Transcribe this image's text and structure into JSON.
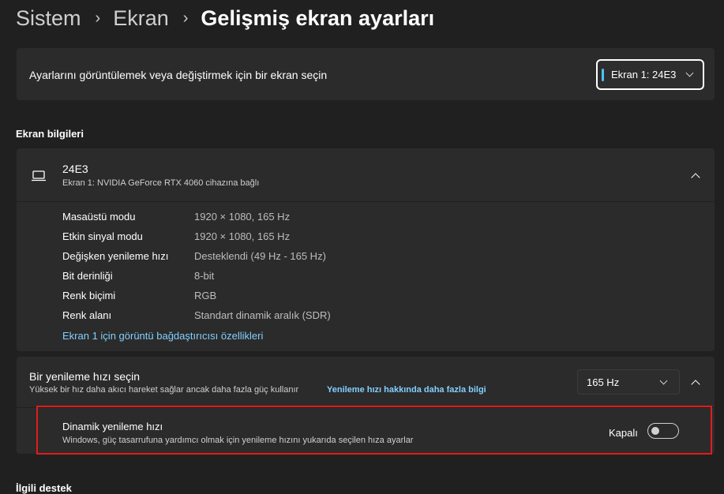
{
  "breadcrumb": {
    "items": [
      "Sistem",
      "Ekran"
    ],
    "current": "Gelişmiş ekran ayarları",
    "separator": "›"
  },
  "display_select": {
    "label": "Ayarlarını görüntülemek veya değiştirmek için bir ekran seçin",
    "value": "Ekran 1: 24E3"
  },
  "display_info": {
    "section_title": "Ekran bilgileri",
    "monitor_name": "24E3",
    "monitor_desc": "Ekran 1: NVIDIA GeForce RTX 4060 cihazına bağlı",
    "rows": [
      {
        "label": "Masaüstü modu",
        "value": "1920 × 1080, 165 Hz"
      },
      {
        "label": "Etkin sinyal modu",
        "value": "1920 × 1080, 165 Hz"
      },
      {
        "label": "Değişken yenileme hızı",
        "value": "Desteklendi (49 Hz - 165 Hz)"
      },
      {
        "label": "Bit derinliği",
        "value": "8-bit"
      },
      {
        "label": "Renk biçimi",
        "value": "RGB"
      },
      {
        "label": "Renk alanı",
        "value": "Standart dinamik aralık (SDR)"
      }
    ],
    "adapter_link": "Ekran 1 için görüntü bağdaştırıcısı özellikleri"
  },
  "refresh": {
    "title": "Bir yenileme hızı seçin",
    "desc": "Yüksek bir hız daha akıcı hareket sağlar ancak daha fazla güç kullanır",
    "learn_more": "Yenileme hızı hakkında daha fazla bilgi",
    "value": "165 Hz",
    "dynamic": {
      "title": "Dinamik yenileme hızı",
      "desc": "Windows, güç tasarrufuna yardımcı olmak için yenileme hızını yukarıda seçilen hıza ayarlar",
      "state_label": "Kapalı",
      "enabled": false
    }
  },
  "related": {
    "title": "İlgili destek"
  },
  "colors": {
    "accent": "#4cc2ff",
    "link": "#82cfff",
    "highlight_border": "#e21b1b"
  }
}
